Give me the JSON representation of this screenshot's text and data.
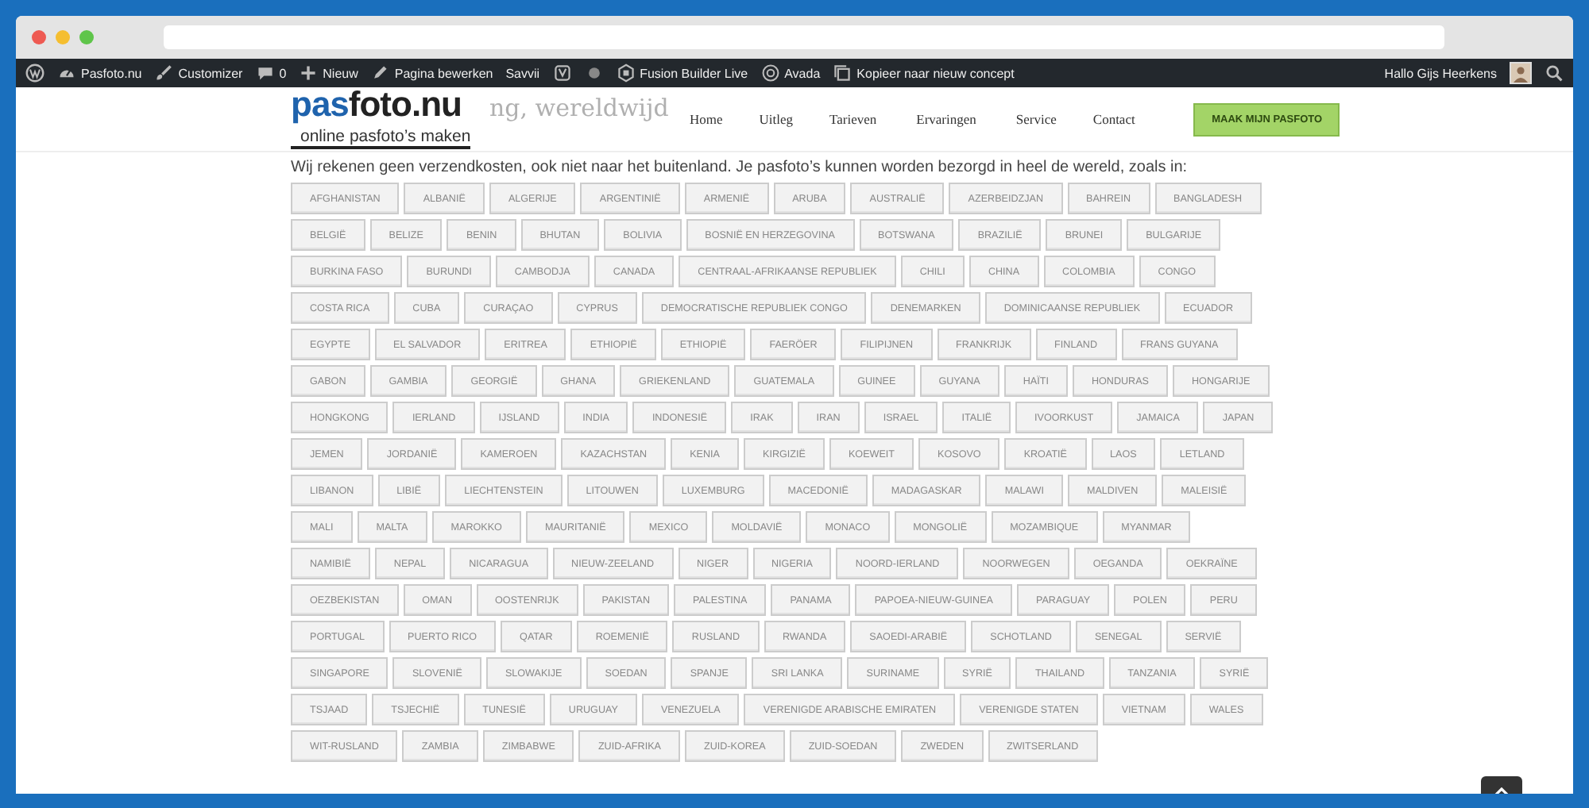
{
  "admin_bar": {
    "site": "Pasfoto.nu",
    "customizer": "Customizer",
    "comments": "0",
    "new": "Nieuw",
    "edit": "Pagina bewerken",
    "host": "Savvii",
    "builder": "Fusion Builder Live",
    "theme": "Avada",
    "copy": "Kopieer naar nieuw concept",
    "greeting": "Hallo Gijs Heerkens"
  },
  "header": {
    "logo": {
      "accent": "pas",
      "rest": "foto.nu",
      "tagline": "online pasfoto’s maken"
    },
    "heading_fragment": "ng, wereldwijd",
    "nav": [
      {
        "label": "Home"
      },
      {
        "label": "Uitleg"
      },
      {
        "label": "Tarieven"
      },
      {
        "label": "Ervaringen"
      },
      {
        "label": "Service"
      },
      {
        "label": "Contact"
      }
    ],
    "cta": "MAAK MIJN PASFOTO"
  },
  "intro": "Wij rekenen geen verzendkosten, ook niet naar het buitenland. Je pasfoto’s kunnen worden bezorgd in heel de wereld, zoals in:",
  "country_rows": [
    [
      "AFGHANISTAN",
      "ALBANIË",
      "ALGERIJE",
      "ARGENTINIË",
      "ARMENIË",
      "ARUBA",
      "AUSTRALIË",
      "AZERBEIDZJAN",
      "BAHREIN",
      "BANGLADESH"
    ],
    [
      "BELGIË",
      "BELIZE",
      "BENIN",
      "BHUTAN",
      "BOLIVIA",
      "BOSNIË EN HERZEGOVINA",
      "BOTSWANA",
      "BRAZILIË",
      "BRUNEI",
      "BULGARIJE"
    ],
    [
      "BURKINA FASO",
      "BURUNDI",
      "CAMBODJA",
      "CANADA",
      "CENTRAAL-AFRIKAANSE REPUBLIEK",
      "CHILI",
      "CHINA",
      "COLOMBIA",
      "CONGO"
    ],
    [
      "COSTA RICA",
      "CUBA",
      "CURAÇAO",
      "CYPRUS",
      "DEMOCRATISCHE REPUBLIEK CONGO",
      "DENEMARKEN",
      "DOMINICAANSE REPUBLIEK",
      "ECUADOR"
    ],
    [
      "EGYPTE",
      "EL SALVADOR",
      "ERITREA",
      "ETHIOPIË",
      "ETHIOPIË",
      "FAERÖER",
      "FILIPIJNEN",
      "FRANKRIJK",
      "FINLAND",
      "FRANS GUYANA"
    ],
    [
      "GABON",
      "GAMBIA",
      "GEORGIË",
      "GHANA",
      "GRIEKENLAND",
      "GUATEMALA",
      "GUINEE",
      "GUYANA",
      "HAÏTI",
      "HONDURAS",
      "HONGARIJE"
    ],
    [
      "HONGKONG",
      "IERLAND",
      "IJSLAND",
      "INDIA",
      "INDONESIË",
      "IRAK",
      "IRAN",
      "ISRAEL",
      "ITALIË",
      "IVOORKUST",
      "JAMAICA",
      "JAPAN"
    ],
    [
      "JEMEN",
      "JORDANIË",
      "KAMEROEN",
      "KAZACHSTAN",
      "KENIA",
      "KIRGIZIË",
      "KOEWEIT",
      "KOSOVO",
      "KROATIË",
      "LAOS",
      "LETLAND"
    ],
    [
      "LIBANON",
      "LIBIË",
      "LIECHTENSTEIN",
      "LITOUWEN",
      "LUXEMBURG",
      "MACEDONIË",
      "MADAGASKAR",
      "MALAWI",
      "MALDIVEN",
      "MALEISIË"
    ],
    [
      "MALI",
      "MALTA",
      "MAROKKO",
      "MAURITANIË",
      "MEXICO",
      "MOLDAVIË",
      "MONACO",
      "MONGOLIË",
      "MOZAMBIQUE",
      "MYANMAR"
    ],
    [
      "NAMIBIË",
      "NEPAL",
      "NICARAGUA",
      "NIEUW-ZEELAND",
      "NIGER",
      "NIGERIA",
      "NOORD-IERLAND",
      "NOORWEGEN",
      "OEGANDA",
      "OEKRAÏNE"
    ],
    [
      "OEZBEKISTAN",
      "OMAN",
      "OOSTENRIJK",
      "PAKISTAN",
      "PALESTINA",
      "PANAMA",
      "PAPOEA-NIEUW-GUINEA",
      "PARAGUAY",
      "POLEN",
      "PERU"
    ],
    [
      "PORTUGAL",
      "PUERTO RICO",
      "QATAR",
      "ROEMENIË",
      "RUSLAND",
      "RWANDA",
      "SAOEDI-ARABIË",
      "SCHOTLAND",
      "SENEGAL",
      "SERVIË"
    ],
    [
      "SINGAPORE",
      "SLOVENIË",
      "SLOWAKIJE",
      "SOEDAN",
      "SPANJE",
      "SRI LANKA",
      "SURINAME",
      "SYRIË",
      "THAILAND",
      "TANZANIA",
      "SYRIË"
    ],
    [
      "TSJAAD",
      "TSJECHIË",
      "TUNESIË",
      "URUGUAY",
      "VENEZUELA",
      "VERENIGDE ARABISCHE EMIRATEN",
      "VERENIGDE STATEN",
      "VIETNAM",
      "WALES"
    ],
    [
      "WIT-RUSLAND",
      "ZAMBIA",
      "ZIMBABWE",
      "ZUID-AFRIKA",
      "ZUID-KOREA",
      "ZUID-SOEDAN",
      "ZWEDEN",
      "ZWITSERLAND"
    ]
  ]
}
